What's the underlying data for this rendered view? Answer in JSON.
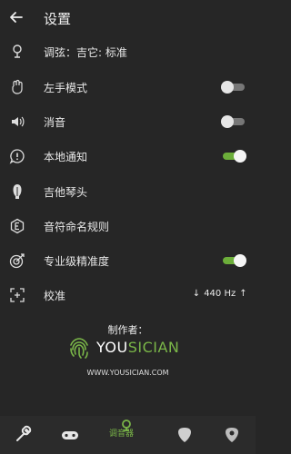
{
  "header": {
    "title": "设置"
  },
  "rows": [
    {
      "label": "调弦：吉它: 标准",
      "icon": "tuning-fork-icon"
    },
    {
      "label": "左手模式",
      "icon": "hand-icon",
      "toggle": false
    },
    {
      "label": "消音",
      "icon": "speaker-icon",
      "toggle": false
    },
    {
      "label": "本地通知",
      "icon": "notification-icon",
      "toggle": true
    },
    {
      "label": "吉他琴头",
      "icon": "guitar-head-icon"
    },
    {
      "label": "音符命名规则",
      "icon": "note-naming-icon"
    },
    {
      "label": "专业级精准度",
      "icon": "target-icon",
      "toggle": true
    },
    {
      "label": "校准",
      "icon": "calibrate-icon",
      "value": "440 Hz"
    }
  ],
  "credit": {
    "label": "制作者：",
    "brand_prefix": "YOU",
    "brand_suffix": "SICIAN",
    "url": "WWW.YOUSICIAN.COM"
  },
  "tabbar": {
    "tabs": [
      "wrench-icon",
      "controller-icon",
      "tuner-icon",
      "guitar-pick-icon",
      "user-icon"
    ],
    "active_label": "调音器"
  },
  "colors": {
    "accent": "#7ab648",
    "background": "#262626"
  }
}
